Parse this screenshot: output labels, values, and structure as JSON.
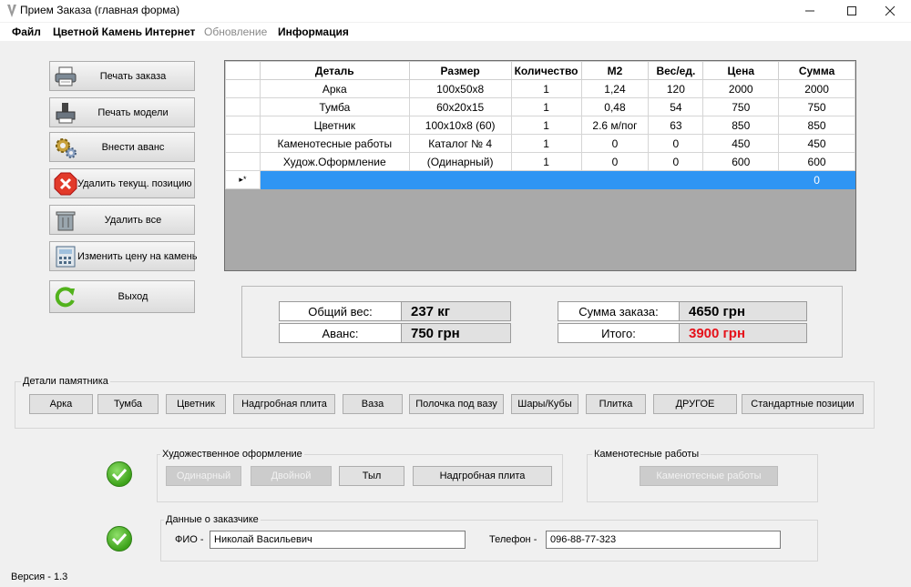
{
  "window": {
    "title": "Прием Заказа (главная форма)"
  },
  "menu": [
    {
      "label": "Файл",
      "enabled": true
    },
    {
      "label": "Цветной Камень",
      "enabled": true
    },
    {
      "label": "Интернет",
      "enabled": true
    },
    {
      "label": "Обновление",
      "enabled": false
    },
    {
      "label": "Информация",
      "enabled": true
    }
  ],
  "side_buttons": {
    "print_order": "Печать заказа",
    "print_model": "Печать модели",
    "add_advance": "Внести аванс",
    "delete_current": "Удалить текущ. позицию",
    "delete_all": "Удалить все",
    "change_price": "Изменить цену на камень",
    "exit": "Выход"
  },
  "grid": {
    "columns": [
      "Деталь",
      "Размер",
      "Количество",
      "М2",
      "Вес/ед.",
      "Цена",
      "Сумма"
    ],
    "rows": [
      [
        "Арка",
        "100x50x8",
        "1",
        "1,24",
        "120",
        "2000",
        "2000"
      ],
      [
        "Тумба",
        "60x20x15",
        "1",
        "0,48",
        "54",
        "750",
        "750"
      ],
      [
        "Цветник",
        "100x10x8 (60)",
        "1",
        "2.6 м/пог",
        "63",
        "850",
        "850"
      ],
      [
        "Каменотесные работы",
        "Каталог № 4",
        "1",
        "0",
        "0",
        "450",
        "450"
      ],
      [
        "Худож.Оформление",
        "(Одинарный)",
        "1",
        "0",
        "0",
        "600",
        "600"
      ]
    ],
    "new_row_marker": "▸*",
    "new_row_sum": "0"
  },
  "totals": {
    "weight_label": "Общий вес:",
    "weight_value": "237 кг",
    "advance_label": "Аванс:",
    "advance_value": "750 грн",
    "order_sum_label": "Сумма заказа:",
    "order_sum_value": "4650 грн",
    "total_label": "Итого:",
    "total_value": "3900 грн"
  },
  "details": {
    "title": "Детали памятника",
    "buttons": [
      "Арка",
      "Тумба",
      "Цветник",
      "Надгробная плита",
      "Ваза",
      "Полочка под вазу",
      "Шары/Кубы",
      "Плитка",
      "ДРУГОЕ",
      "Стандартные позиции"
    ]
  },
  "art": {
    "title": "Художественное оформление",
    "single": "Одинарный",
    "double": "Двойной",
    "back": "Тыл",
    "tombstone": "Надгробная плита"
  },
  "stonework": {
    "title": "Каменотесные работы",
    "button": "Каменотесные работы"
  },
  "customer": {
    "title": "Данные о заказчике",
    "name_label": "ФИО -",
    "name_value": "Николай Васильевич",
    "phone_label": "Телефон -",
    "phone_value": "096-88-77-323"
  },
  "version": "Версия - 1.3",
  "colors": {
    "selection": "#2f95f3",
    "total_red": "#e5111a",
    "check_green": "#3da21a"
  }
}
